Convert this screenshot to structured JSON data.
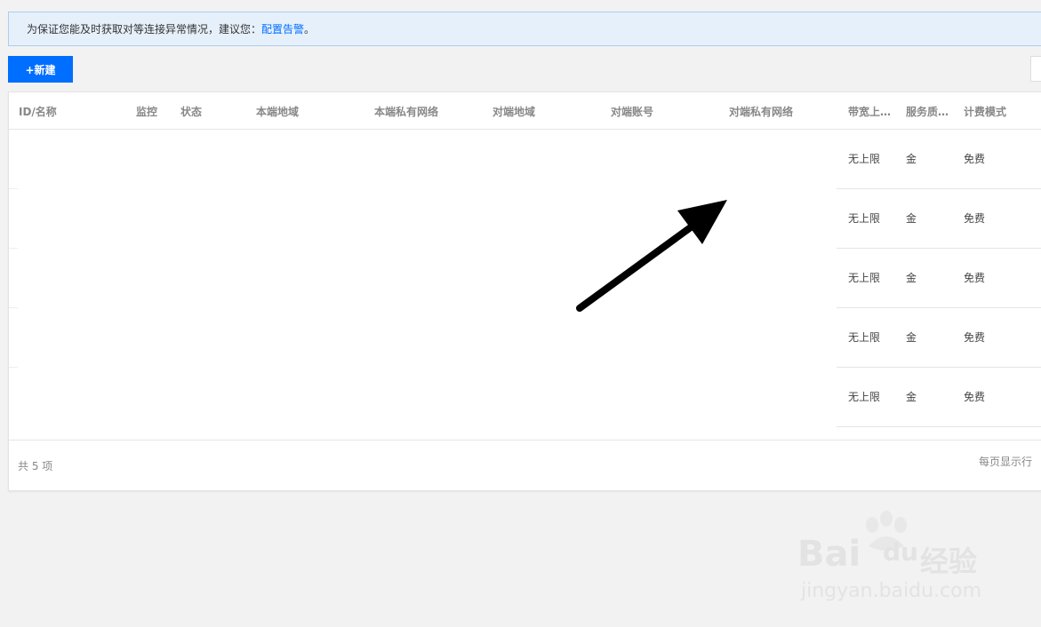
{
  "notice": {
    "text": "为保证您能及时获取对等连接异常情况，建议您：",
    "link": "配置告警",
    "end": "。"
  },
  "toolbar": {
    "new_label": "+新建"
  },
  "table": {
    "columns": [
      "ID/名称",
      "监控",
      "状态",
      "本端地域",
      "本端私有网络",
      "对端地域",
      "对端账号",
      "对端私有网络",
      "带宽上…",
      "服务质…",
      "计费模式"
    ],
    "rows": [
      {
        "bandwidth": "无上限",
        "quality": "金",
        "billing": "免费"
      },
      {
        "bandwidth": "无上限",
        "quality": "金",
        "billing": "免费"
      },
      {
        "bandwidth": "无上限",
        "quality": "金",
        "billing": "免费"
      },
      {
        "bandwidth": "无上限",
        "quality": "金",
        "billing": "免费"
      },
      {
        "bandwidth": "无上限",
        "quality": "金",
        "billing": "免费"
      }
    ]
  },
  "pagination": {
    "total": "共 5 项",
    "per_page_label": "每页显示行"
  },
  "annotation": {
    "icon": "arrow-icon",
    "color": "#000000"
  },
  "watermark": {
    "brand": "Bai",
    "brand2": "du",
    "product": "经验",
    "url": "jingyan.baidu.com"
  },
  "colors": {
    "primary": "#006eff",
    "notice_bg": "#e6f0fb",
    "notice_border": "#a9cdf2"
  }
}
